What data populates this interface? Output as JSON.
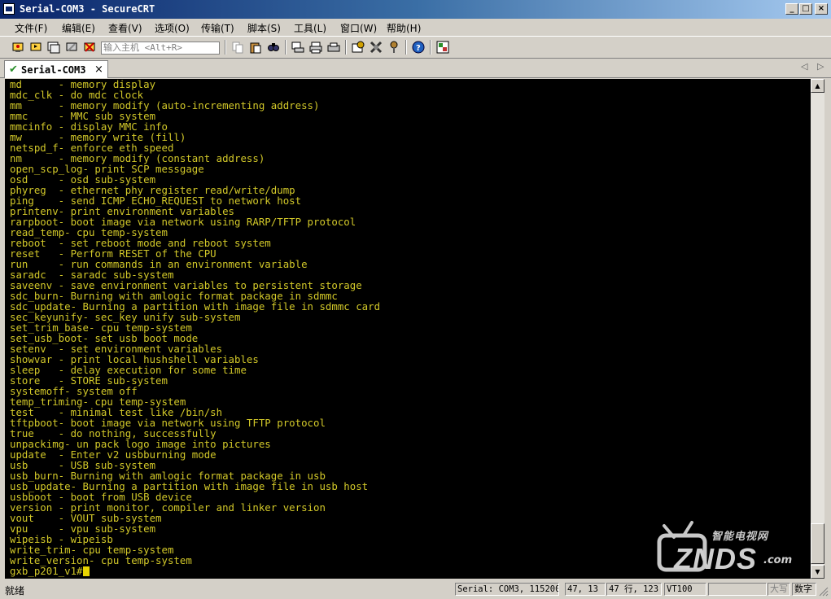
{
  "window": {
    "title": "Serial-COM3 - SecureCRT",
    "controls": {
      "minimize": "_",
      "maximize": "□",
      "close": "×"
    }
  },
  "menu": [
    "文件(F)",
    "编辑(E)",
    "查看(V)",
    "选项(O)",
    "传输(T)",
    "脚本(S)",
    "工具(L)",
    "窗口(W)",
    "帮助(H)"
  ],
  "toolbar": {
    "quick_connect_placeholder": "输入主机 <Alt+R>",
    "icons": [
      "connect-icon",
      "quick-connect-icon",
      "connect-in-tab-icon",
      "reconnect-icon",
      "disconnect-icon",
      "copy-icon",
      "paste-icon",
      "find-icon",
      "print-screen-icon",
      "print-icon",
      "print-setup-icon",
      "session-options-icon",
      "global-options-icon",
      "keymap-icon",
      "help-icon",
      "sftp-icon"
    ]
  },
  "tab": {
    "label": "Serial-COM3",
    "close": "×",
    "nav_prev": "◁",
    "nav_next": "▷"
  },
  "terminal": {
    "lines": [
      "md      - memory display",
      "mdc_clk - do mdc clock",
      "mm      - memory modify (auto-incrementing address)",
      "mmc     - MMC sub system",
      "mmcinfo - display MMC info",
      "mw      - memory write (fill)",
      "netspd_f- enforce eth speed",
      "nm      - memory modify (constant address)",
      "open_scp_log- print SCP messgage",
      "osd     - osd sub-system",
      "phyreg  - ethernet phy register read/write/dump",
      "ping    - send ICMP ECHO_REQUEST to network host",
      "printenv- print environment variables",
      "rarpboot- boot image via network using RARP/TFTP protocol",
      "read_temp- cpu temp-system",
      "reboot  - set reboot mode and reboot system",
      "reset   - Perform RESET of the CPU",
      "run     - run commands in an environment variable",
      "saradc  - saradc sub-system",
      "saveenv - save environment variables to persistent storage",
      "sdc_burn- Burning with amlogic format package in sdmmc",
      "sdc_update- Burning a partition with image file in sdmmc card",
      "sec_keyunify- sec_key unify sub-system",
      "set_trim_base- cpu temp-system",
      "set_usb_boot- set usb boot mode",
      "setenv  - set environment variables",
      "showvar - print local hushshell variables",
      "sleep   - delay execution for some time",
      "store   - STORE sub-system",
      "systemoff- system off",
      "temp_triming- cpu temp-system",
      "test    - minimal test like /bin/sh",
      "tftpboot- boot image via network using TFTP protocol",
      "true    - do nothing, successfully",
      "unpackimg- un pack logo image into pictures",
      "update  - Enter v2 usbburning mode",
      "usb     - USB sub-system",
      "usb_burn- Burning with amlogic format package in usb",
      "usb_update- Burning a partition with image file in usb host",
      "usbboot - boot from USB device",
      "version - print monitor, compiler and linker version",
      "vout    - VOUT sub-system",
      "vpu     - vpu sub-system",
      "wipeisb - wipeisb",
      "write_trim- cpu temp-system",
      "write_version- cpu temp-system"
    ],
    "prompt": "gxb_p201_v1#",
    "text_color": "#d2c829",
    "background": "#000000"
  },
  "watermark": {
    "cn": "智能电视网",
    "logo": "ZNDS",
    "suffix": ".com"
  },
  "status": {
    "text": "就绪",
    "connection": "Serial: COM3, 115200",
    "cursor_pos": "47,  13",
    "rows_cols": "47 行, 123 列",
    "terminal_type": "VT100",
    "caps": "大写",
    "numlock": "数字"
  }
}
